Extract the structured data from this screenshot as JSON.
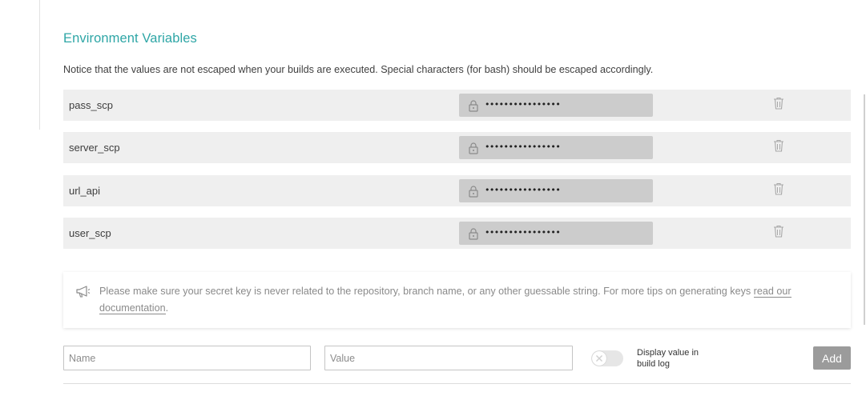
{
  "section": {
    "title": "Environment Variables",
    "notice": "Notice that the values are not escaped when your builds are executed. Special characters (for bash) should be escaped accordingly."
  },
  "variables": [
    {
      "name": "pass_scp",
      "value": "••••••••••••••••"
    },
    {
      "name": "server_scp",
      "value": "••••••••••••••••"
    },
    {
      "name": "url_api",
      "value": "••••••••••••••••"
    },
    {
      "name": "user_scp",
      "value": "••••••••••••••••"
    }
  ],
  "icons": {
    "lock": "lock-icon",
    "delete": "trash-icon",
    "tip": "megaphone-icon",
    "toggle_off": "close-icon"
  },
  "tip": {
    "text": "Please make sure your secret key is never related to the repository, branch name, or any other guessable string. For more tips on generating keys ",
    "link": "read our documentation",
    "end": "."
  },
  "form": {
    "name_placeholder": "Name",
    "value_placeholder": "Value",
    "toggle_label": "Display value in build log",
    "toggle_on": false,
    "add_label": "Add"
  },
  "colors": {
    "accent": "#2ea6a6",
    "row_bg": "#efefef",
    "masked_bg": "#cccccc",
    "button_bg": "#9b9b9b"
  }
}
